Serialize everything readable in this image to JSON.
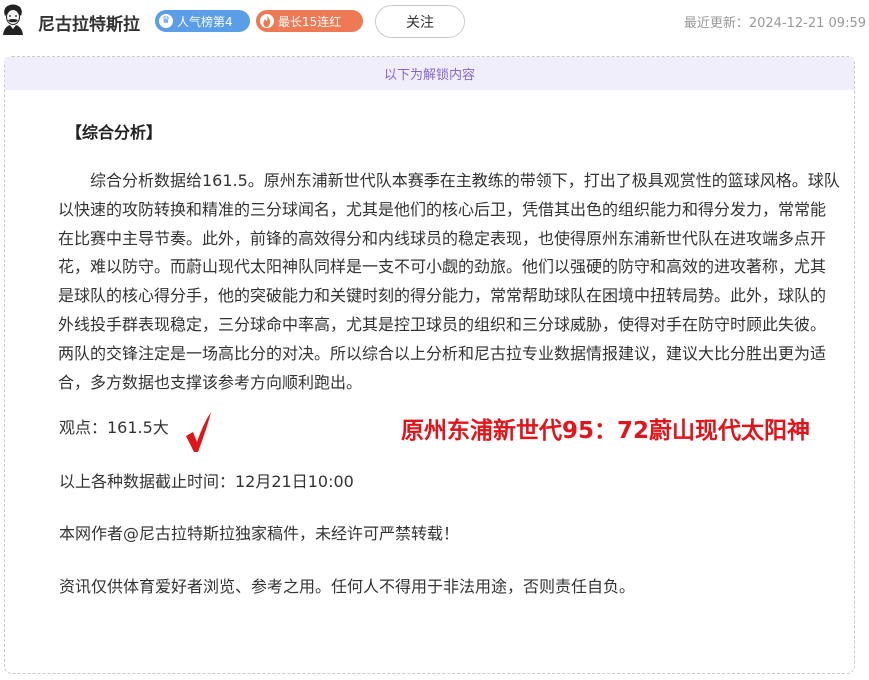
{
  "header": {
    "author_name": "尼古拉特斯拉",
    "rank_badge": "人气榜第4",
    "streak_badge": "最长15连红",
    "follow_label": "关注",
    "update_time": "最近更新：2024-12-21 09:59"
  },
  "content": {
    "unlock_notice": "以下为解锁内容",
    "section_title": "【综合分析】",
    "analysis_text": "综合分析数据给161.5。原州东浦新世代队本赛季在主教练的带领下，打出了极具观赏性的篮球风格。球队以快速的攻防转换和精准的三分球闻名，尤其是他们的核心后卫，凭借其出色的组织能力和得分发力，常常能在比赛中主导节奏。此外，前锋的高效得分和内线球员的稳定表现，也使得原州东浦新世代队在进攻端多点开花，难以防守。而蔚山现代太阳神队同样是一支不可小觑的劲旅。他们以强硬的防守和高效的进攻著称，尤其是球队的核心得分手，他的突破能力和关键时刻的得分能力，常常帮助球队在困境中扭转局势。此外，球队的外线投手群表现稳定，三分球命中率高，尤其是控卫球员的组织和三分球威胁，使得对手在防守时顾此失彼。两队的交锋注定是一场高比分的对决。所以综合以上分析和尼古拉专业数据情报建议，建议大比分胜出更为适合，多方数据也支撑该参考方向顺利跑出。",
    "viewpoint": "观点：161.5大",
    "final_score": "原州东浦新世代95：72蔚山现代太阳神",
    "cutoff_time": "以上各种数据截止时间：12月21日10:00",
    "copyright": "本网作者@尼古拉特斯拉独家稿件，未经许可严禁转载！",
    "disclaimer": "资讯仅供体育爱好者浏览、参考之用。任何人不得用于非法用途，否则责任自负。"
  },
  "colors": {
    "accent_purple": "#8466c9",
    "rank_badge_bg": "#5a9ee8",
    "streak_badge_bg": "#ee7a55",
    "score_red": "#e1141a"
  },
  "icons": {
    "avatar": "portrait-sketch",
    "rank_badge_icon": "crown-icon",
    "streak_badge_icon": "flame-icon",
    "check": "checkmark-icon"
  }
}
